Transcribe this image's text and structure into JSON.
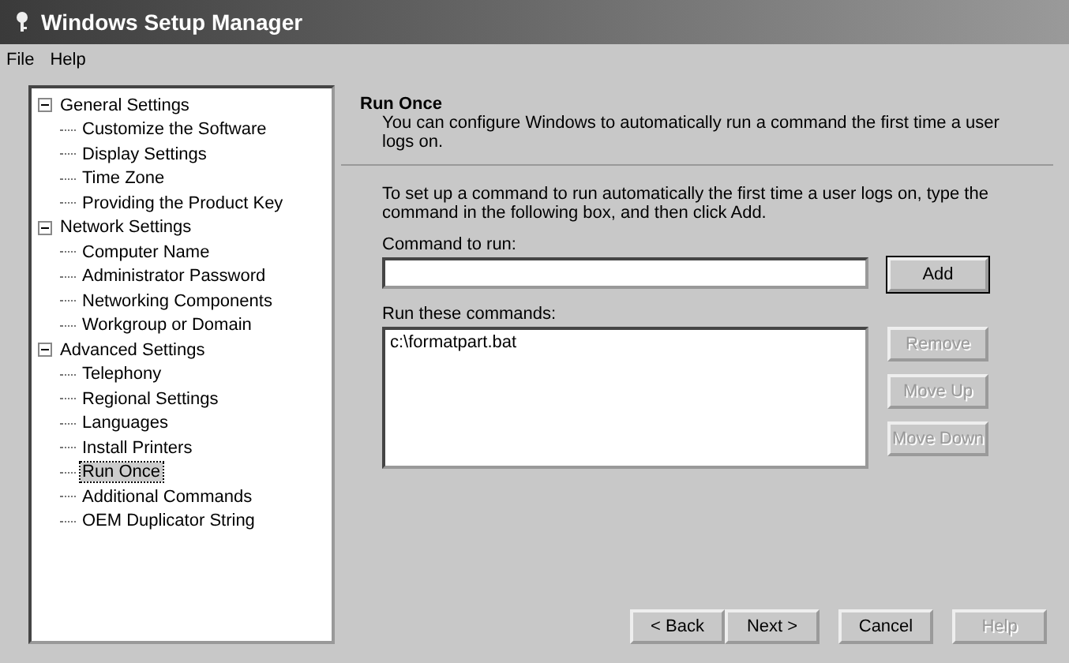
{
  "window": {
    "title": "Windows Setup Manager"
  },
  "menu": [
    "File",
    "Help"
  ],
  "tree": [
    {
      "label": "General Settings",
      "expanded": true,
      "selected": false,
      "children": [
        {
          "label": "Customize the Software",
          "selected": false
        },
        {
          "label": "Display Settings",
          "selected": false
        },
        {
          "label": "Time Zone",
          "selected": false
        },
        {
          "label": "Providing the Product Key",
          "selected": false
        }
      ]
    },
    {
      "label": "Network Settings",
      "expanded": true,
      "selected": false,
      "children": [
        {
          "label": "Computer Name",
          "selected": false
        },
        {
          "label": "Administrator Password",
          "selected": false
        },
        {
          "label": "Networking Components",
          "selected": false
        },
        {
          "label": "Workgroup or Domain",
          "selected": false
        }
      ]
    },
    {
      "label": "Advanced Settings",
      "expanded": true,
      "selected": false,
      "children": [
        {
          "label": "Telephony",
          "selected": false
        },
        {
          "label": "Regional Settings",
          "selected": false
        },
        {
          "label": "Languages",
          "selected": false
        },
        {
          "label": "Install Printers",
          "selected": false
        },
        {
          "label": "Run Once",
          "selected": true
        },
        {
          "label": "Additional Commands",
          "selected": false
        },
        {
          "label": "OEM Duplicator String",
          "selected": false
        }
      ]
    }
  ],
  "page": {
    "title": "Run Once",
    "subtitle": "You can configure Windows to automatically run a command the first time a user logs on.",
    "instructions": "To set up a command to run automatically the first time a user logs on, type the command in the following box, and then click Add.",
    "command_label": "Command to run:",
    "add_button": {
      "label": "Add",
      "disabled": false
    },
    "list_label": "Run these commands:",
    "commands": [
      "c:\\formatpart.bat"
    ],
    "side_buttons": [
      {
        "label": "Remove",
        "disabled": true
      },
      {
        "label": "Move Up",
        "disabled": true
      },
      {
        "label": "Move Down",
        "disabled": true
      }
    ]
  },
  "footer_buttons": [
    {
      "label": "< Back",
      "disabled": false
    },
    {
      "label": "Next >",
      "disabled": false
    },
    {
      "label": "Cancel",
      "disabled": false
    },
    {
      "label": "Help",
      "disabled": true
    }
  ]
}
